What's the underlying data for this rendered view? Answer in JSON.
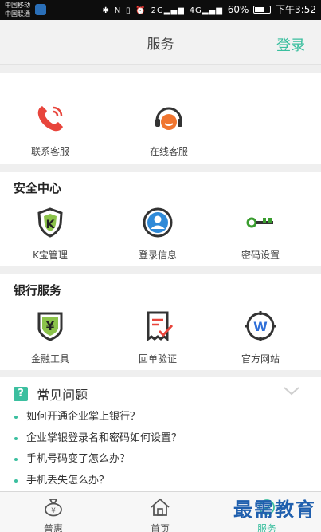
{
  "status_bar": {
    "carrier_1": "中国移动",
    "carrier_2": "中国联通",
    "signal_1": "2G",
    "signal_2": "4G",
    "battery": "60%",
    "time": "下午3:52"
  },
  "header": {
    "title": "服务",
    "login": "登录"
  },
  "contact": {
    "items": [
      {
        "label": "联系客服",
        "icon": "phone-icon"
      },
      {
        "label": "在线客服",
        "icon": "headset-icon"
      }
    ]
  },
  "security": {
    "title": "安全中心",
    "items": [
      {
        "label": "K宝管理",
        "icon": "k-shield-icon"
      },
      {
        "label": "登录信息",
        "icon": "user-icon"
      },
      {
        "label": "密码设置",
        "icon": "key-icon"
      }
    ]
  },
  "bank": {
    "title": "银行服务",
    "items": [
      {
        "label": "金融工具",
        "icon": "yen-shield-icon"
      },
      {
        "label": "回单验证",
        "icon": "receipt-icon"
      },
      {
        "label": "官方网站",
        "icon": "website-icon"
      }
    ]
  },
  "faq": {
    "badge": "?",
    "title": "常见问题",
    "questions": [
      "如何开通企业掌上银行？",
      "企业掌银登录名和密码如何设置？",
      "手机号码变了怎么办？",
      "手机丢失怎么办？"
    ]
  },
  "nav": {
    "items": [
      {
        "label": "普惠",
        "icon": "money-bag-icon"
      },
      {
        "label": "首页",
        "icon": "home-icon"
      },
      {
        "label": "服务",
        "icon": "service-icon",
        "active": true
      }
    ]
  },
  "watermark": "最需教育",
  "colors": {
    "accent": "#3bbf9f",
    "phone_red": "#e8453c",
    "headset_orange": "#f0752f",
    "key_green": "#3a9d2f",
    "receipt_red": "#e8453c",
    "watermark_blue": "#1f5fae"
  }
}
